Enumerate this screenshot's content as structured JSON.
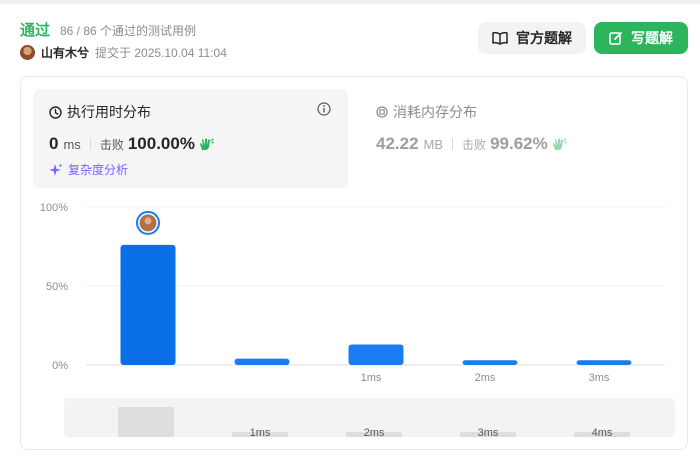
{
  "header": {
    "status": "通过",
    "pass_info": "86 / 86 个通过的测试用例",
    "author": "山有木兮",
    "submitted": "提交于 2025.10.04 11:04",
    "solution_button": "官方题解",
    "write_button": "写题解"
  },
  "runtime": {
    "title": "执行用时分布",
    "value": "0",
    "unit": "ms",
    "beat_label": "击败",
    "percent": "100.00%",
    "complexity_link": "复杂度分析"
  },
  "memory": {
    "title": "消耗内存分布",
    "value": "42.22",
    "unit": "MB",
    "beat_label": "击败",
    "percent": "99.62%"
  },
  "colors": {
    "accent_green": "#2db55d",
    "bar_selected": "#0a6ee6",
    "bar": "#1a7cf0",
    "purple": "#7b61ff"
  },
  "chart_data": {
    "type": "bar",
    "categories": [
      "",
      "1ms",
      "2ms",
      "3ms",
      "4ms"
    ],
    "values": [
      76,
      4,
      13,
      3,
      3
    ],
    "selected_index": 0,
    "yticks": [
      "100%",
      "50%",
      "0%"
    ],
    "ylim": [
      0,
      100
    ],
    "grid": true,
    "navigator_labels": [
      "",
      "1ms",
      "2ms",
      "3ms",
      "4ms"
    ]
  }
}
